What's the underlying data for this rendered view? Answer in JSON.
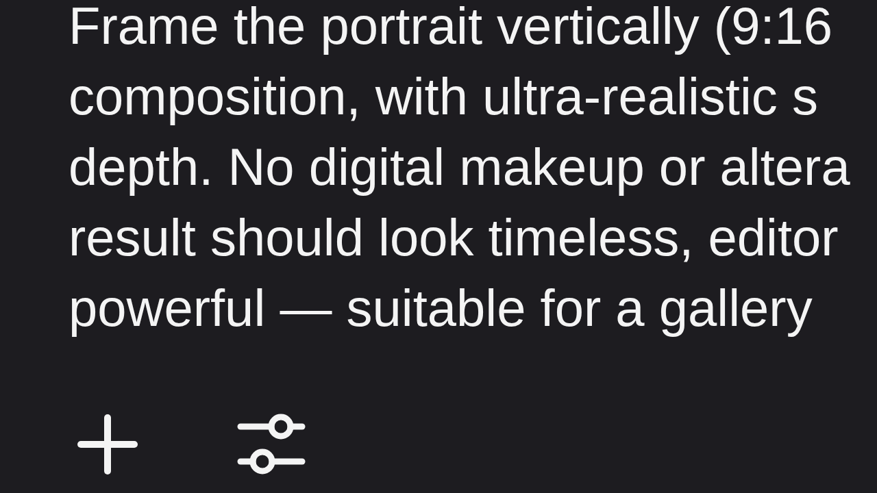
{
  "prompt": {
    "lines": [
      "Frame the portrait vertically (9:16",
      "composition, with ultra-realistic s",
      "depth. No digital makeup or altera",
      "result should look timeless, editor",
      "powerful — suitable for a gallery"
    ]
  }
}
